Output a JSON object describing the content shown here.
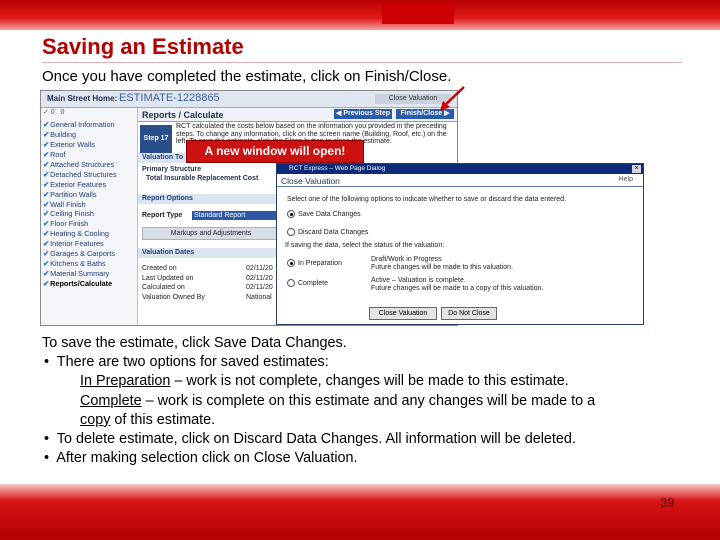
{
  "slide": {
    "title": "Saving an Estimate",
    "intro": "Once you have completed the estimate, click on Finish/Close.",
    "callout": "A new window will open!",
    "page_number": "39"
  },
  "app": {
    "home_label": "Main Street Home:",
    "estimate_id": "ESTIMATE-1228865",
    "close_valuation": "Close Valuation",
    "toolbar_left": "✓ 0",
    "toolbar_right": "0",
    "section_title": "Reports / Calculate",
    "prev_button": "◀ Previous Step",
    "finish_button": "Finish/Close ▶",
    "step_label": "Step 17",
    "step_text": "RCT calculated the costs below based on the information you provided in the preceding steps. To change any information, click on the screen name (Building, Roof, etc.) on the left. To save the estimate, click the Close button to close the estimate.",
    "valuation_tab": "Valuation To",
    "primary_structure": "Primary Structure",
    "total_irc": "Total Insurable Replacement Cost",
    "report_options": "Report Options",
    "report_type_label": "Report Type",
    "report_type_value": "Standard Report",
    "markups_button": "Markups and Adjustments",
    "valuation_dates": "Valuation Dates",
    "date_rows": [
      {
        "label": "Created on",
        "value": "02/11/20"
      },
      {
        "label": "Last Updated on",
        "value": "02/11/20"
      },
      {
        "label": "Calculated on",
        "value": "02/11/20"
      },
      {
        "label": "Valuation Owned By",
        "value": "National"
      }
    ],
    "sidebar": [
      "General Information",
      "Building",
      "Exterior Walls",
      "Roof",
      "Attached Structures",
      "Detached Structures",
      "Exterior Features",
      "Partition Walls",
      "Wall Finish",
      "Ceiling Finish",
      "Floor Finish",
      "Heating & Cooling",
      "Interior Features",
      "Garages & Carports",
      "Kitchens & Baths",
      "Material Summary",
      "Reports/Calculate"
    ]
  },
  "dialog": {
    "window_title": "RCT Express – Web Page Dialog",
    "header": "Close Valuation",
    "help": "Help",
    "instruction": "Select one of the following options to indicate whether to save or discard the data entered.",
    "option_save": "Save Data Changes",
    "option_discard": "Discard Data Changes",
    "status_prompt": "If saving the data, select the status of the valuation:",
    "option_in_prep": "In Preparation",
    "in_prep_desc_1": "Draft/Work in Progress",
    "in_prep_desc_2": "Future changes will be made to this valuation.",
    "option_complete": "Complete",
    "complete_desc_1": "Active – Valuation is complete.",
    "complete_desc_2": "Future changes will be made to a copy of this valuation.",
    "close_button": "Close Valuation",
    "cancel_button": "Do Not Close"
  },
  "body": {
    "line1": "To save the estimate, click Save Data Changes.",
    "line2": "There are two options for saved estimates:",
    "in_prep_term": "In Preparation",
    "in_prep_desc": " – work is not complete, changes will be made to this estimate.",
    "complete_term": "Complete",
    "complete_desc": " – work is complete on this estimate and any changes will be made to a",
    "copy_term": "copy",
    "copy_rest": " of this estimate.",
    "line3": "To delete estimate, click on Discard Data Changes.  All information will be deleted.",
    "line4": "After making selection click on Close Valuation."
  },
  "colors": {
    "accent_red": "#cc0000",
    "title_red": "#b00000",
    "app_blue": "#2a5aaa"
  }
}
